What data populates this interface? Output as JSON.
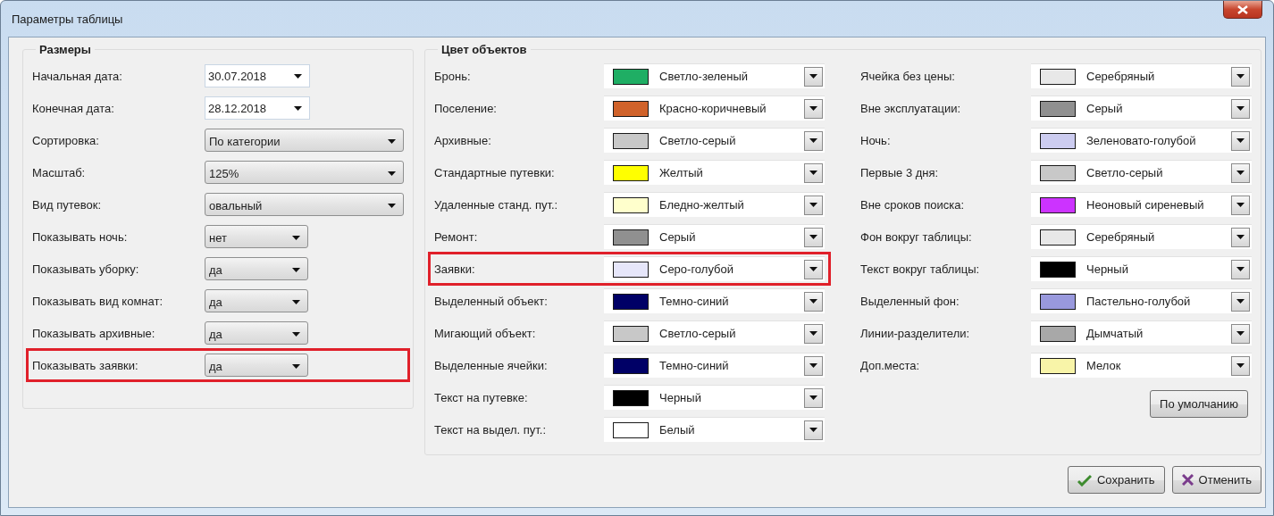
{
  "window": {
    "title": "Параметры таблицы"
  },
  "sizes": {
    "title": "Размеры",
    "rows": [
      {
        "label": "Начальная дата:",
        "value": "30.07.2018",
        "kind": "date",
        "highlighted": false
      },
      {
        "label": "Конечная дата:",
        "value": "28.12.2018",
        "kind": "date",
        "highlighted": false
      },
      {
        "label": "Сортировка:",
        "value": "По категории",
        "kind": "select",
        "highlighted": false
      },
      {
        "label": "Масштаб:",
        "value": "125%",
        "kind": "select",
        "highlighted": false
      },
      {
        "label": "Вид путевок:",
        "value": "овальный",
        "kind": "select",
        "highlighted": false
      },
      {
        "label": "Показывать ночь:",
        "value": "нет",
        "kind": "toggle",
        "highlighted": false
      },
      {
        "label": "Показывать уборку:",
        "value": "да",
        "kind": "toggle",
        "highlighted": false
      },
      {
        "label": "Показывать вид комнат:",
        "value": "да",
        "kind": "toggle",
        "highlighted": false
      },
      {
        "label": "Показывать архивные:",
        "value": "да",
        "kind": "toggle",
        "highlighted": false
      },
      {
        "label": "Показывать заявки:",
        "value": "да",
        "kind": "toggle",
        "highlighted": true
      }
    ]
  },
  "colors": {
    "title": "Цвет объектов",
    "columns": [
      {
        "rows": [
          {
            "label": "Бронь:",
            "value": "Светло-зеленый",
            "color": "#1fae64",
            "highlighted": false
          },
          {
            "label": "Поселение:",
            "value": "Красно-коричневый",
            "color": "#d0622a",
            "highlighted": false
          },
          {
            "label": "Архивные:",
            "value": "Светло-серый",
            "color": "#c8c8c8",
            "highlighted": false
          },
          {
            "label": "Стандартные путевки:",
            "value": "Желтый",
            "color": "#ffff00",
            "highlighted": false
          },
          {
            "label": "Удаленные станд. пут.:",
            "value": "Бледно-желтый",
            "color": "#ffffcc",
            "highlighted": false
          },
          {
            "label": "Ремонт:",
            "value": "Серый",
            "color": "#909090",
            "highlighted": false
          },
          {
            "label": "Заявки:",
            "value": "Серо-голубой",
            "color": "#e6e6fa",
            "highlighted": true
          },
          {
            "label": "Выделенный объект:",
            "value": "Темно-синий",
            "color": "#000066",
            "highlighted": false
          },
          {
            "label": "Мигающий объект:",
            "value": "Светло-серый",
            "color": "#c8c8c8",
            "highlighted": false
          },
          {
            "label": "Выделенные ячейки:",
            "value": "Темно-синий",
            "color": "#000066",
            "highlighted": false
          },
          {
            "label": "Текст на путевке:",
            "value": "Черный",
            "color": "#000000",
            "highlighted": false
          },
          {
            "label": "Текст на выдел. пут.:",
            "value": "Белый",
            "color": "#ffffff",
            "highlighted": false
          }
        ]
      },
      {
        "rows": [
          {
            "label": "Ячейка без цены:",
            "value": "Серебряный",
            "color": "#e8e8e8",
            "highlighted": false
          },
          {
            "label": "Вне эксплуатации:",
            "value": "Серый",
            "color": "#909090",
            "highlighted": false
          },
          {
            "label": "Ночь:",
            "value": "Зеленовато-голубой",
            "color": "#ccccf0",
            "highlighted": false
          },
          {
            "label": "Первые 3 дня:",
            "value": "Светло-серый",
            "color": "#c8c8c8",
            "highlighted": false
          },
          {
            "label": "Вне сроков поиска:",
            "value": "Неоновый сиреневый",
            "color": "#cc33ff",
            "highlighted": false
          },
          {
            "label": "Фон вокруг таблицы:",
            "value": "Серебряный",
            "color": "#e8e8e8",
            "highlighted": false
          },
          {
            "label": "Текст вокруг таблицы:",
            "value": "Черный",
            "color": "#000000",
            "highlighted": false
          },
          {
            "label": "Выделенный фон:",
            "value": "Пастельно-голубой",
            "color": "#9999dd",
            "highlighted": false
          },
          {
            "label": "Линии-разделители:",
            "value": "Дымчатый",
            "color": "#a8a8a8",
            "highlighted": false
          },
          {
            "label": "Доп.места:",
            "value": "Мелок",
            "color": "#f8f4a8",
            "highlighted": false
          }
        ]
      }
    ],
    "default_button": "По умолчанию"
  },
  "buttons": [
    {
      "label": "Сохранить",
      "kind": "save"
    },
    {
      "label": "Отменить",
      "kind": "cancel"
    }
  ]
}
